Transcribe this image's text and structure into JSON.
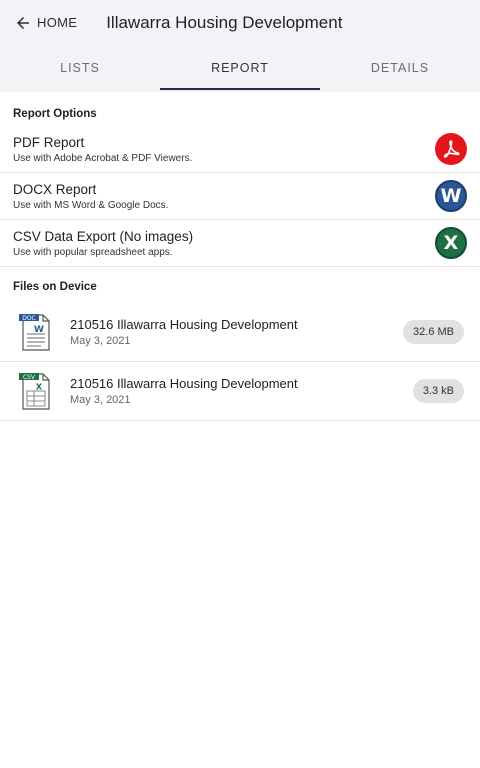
{
  "header": {
    "back_label": "HOME",
    "title": "Illawarra Housing Development"
  },
  "tabs": [
    {
      "label": "LISTS",
      "active": false
    },
    {
      "label": "REPORT",
      "active": true
    },
    {
      "label": "DETAILS",
      "active": false
    }
  ],
  "report_options": {
    "section_title": "Report Options",
    "items": [
      {
        "name": "PDF Report",
        "desc": "Use with Adobe Acrobat & PDF Viewers.",
        "icon": "pdf-icon"
      },
      {
        "name": "DOCX Report",
        "desc": "Use with MS Word & Google Docs.",
        "icon": "word-icon",
        "icon_letter": "W"
      },
      {
        "name": "CSV Data Export (No images)",
        "desc": "Use with popular spreadsheet apps.",
        "icon": "excel-icon",
        "icon_letter": "X"
      }
    ]
  },
  "files": {
    "section_title": "Files on Device",
    "items": [
      {
        "name": "210516 Illawarra Housing Development",
        "date": "May 3, 2021",
        "size": "32.6 MB",
        "type": "DOC",
        "icon": "doc-file-icon"
      },
      {
        "name": "210516 Illawarra Housing Development",
        "date": "May 3, 2021",
        "size": "3.3 kB",
        "type": "CSV",
        "icon": "csv-file-icon"
      }
    ]
  },
  "colors": {
    "header_bg": "#f3f3f7",
    "tab_indicator": "#2b2f45",
    "pdf_red": "#e3161b",
    "word_blue": "#2b5797",
    "excel_green": "#1d7044"
  }
}
